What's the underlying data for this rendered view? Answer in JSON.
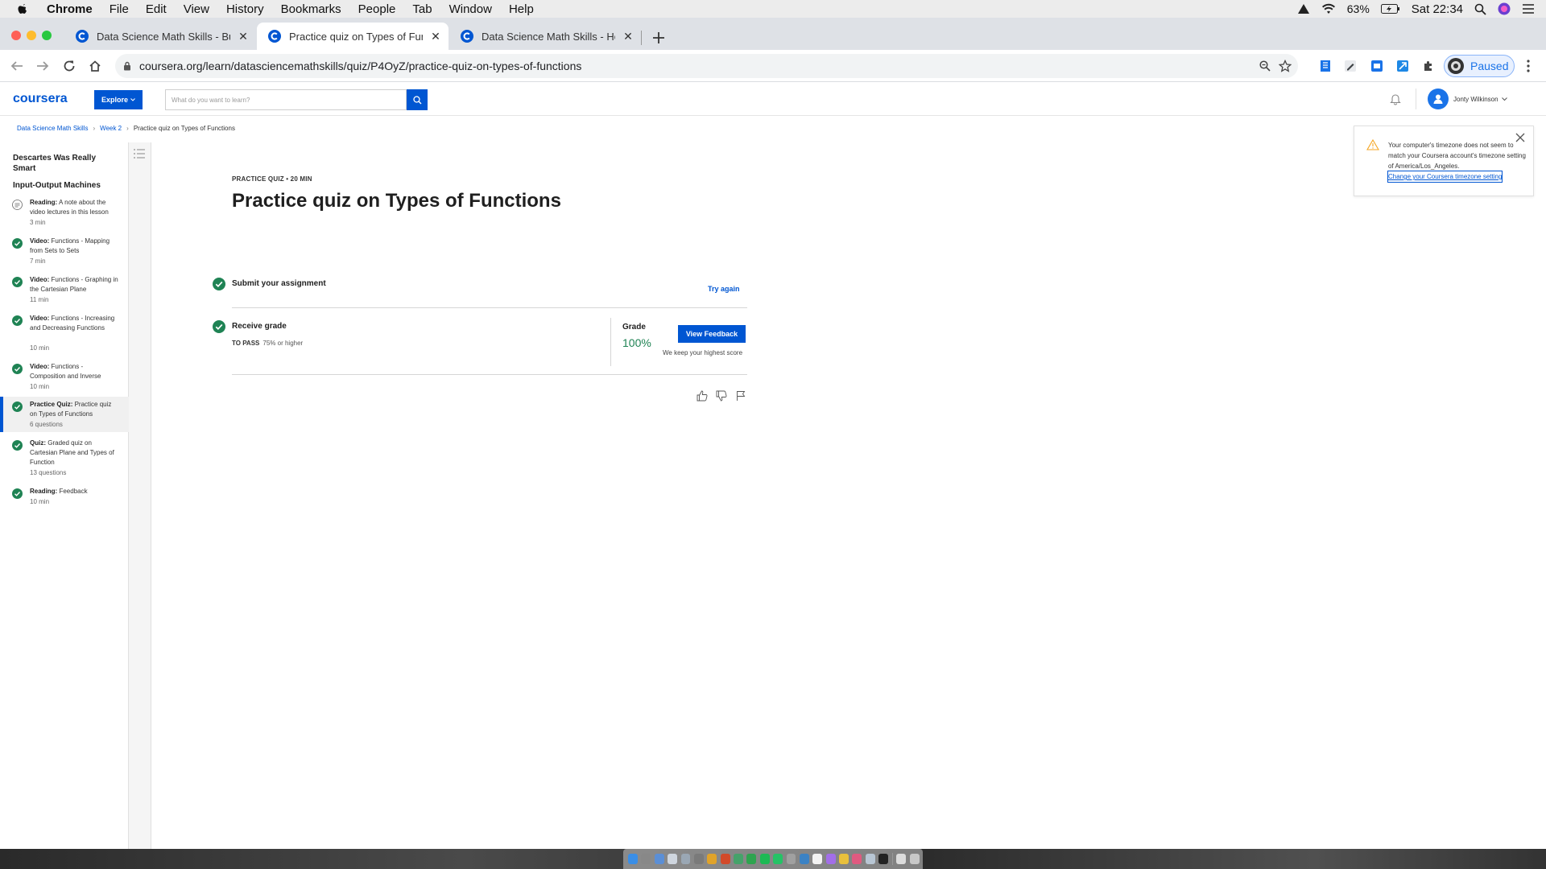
{
  "menubar": {
    "app_name": "Chrome",
    "items": [
      "File",
      "Edit",
      "View",
      "History",
      "Bookmarks",
      "People",
      "Tab",
      "Window",
      "Help"
    ],
    "battery": "63%",
    "clock": "Sat 22:34"
  },
  "browser": {
    "tabs": [
      {
        "title": "Data Science Math Skills - Buil"
      },
      {
        "title": "Practice quiz on Types of Func"
      },
      {
        "title": "Data Science Math Skills - Hon"
      }
    ],
    "url": "coursera.org/learn/datasciencemathskills/quiz/P4OyZ/practice-quiz-on-types-of-functions",
    "profile_status": "Paused"
  },
  "header": {
    "logo": "coursera",
    "explore_label": "Explore",
    "search_placeholder": "What do you want to learn?",
    "user_name": "Jonty Wilkinson"
  },
  "breadcrumb": {
    "course": "Data Science Math Skills",
    "week": "Week 2",
    "current": "Practice quiz on Types of Functions"
  },
  "timezone_notice": {
    "message": "Your computer's timezone does not seem to match your Coursera account's timezone setting of America/Los_Angeles.",
    "link": "Change your Coursera timezone setting"
  },
  "sidebar": {
    "lesson_title": "Descartes Was Really Smart",
    "section_title": "Input-Output Machines",
    "items": [
      {
        "type": "Reading:",
        "title": "A note about the video lectures in this lesson",
        "meta": "3 min"
      },
      {
        "type": "Video:",
        "title": "Functions - Mapping from Sets to Sets",
        "meta": "7 min"
      },
      {
        "type": "Video:",
        "title": "Functions - Graphing in the Cartesian Plane",
        "meta": "11 min"
      },
      {
        "type": "Video:",
        "title": "Functions - Increasing and Decreasing Functions",
        "meta": "10 min"
      },
      {
        "type": "Video:",
        "title": "Functions - Composition and Inverse",
        "meta": "10 min"
      },
      {
        "type": "Practice Quiz:",
        "title": "Practice quiz on Types of Functions",
        "meta": "6 questions"
      },
      {
        "type": "Quiz:",
        "title": "Graded quiz on Cartesian Plane and Types of Function",
        "meta": "13 questions"
      },
      {
        "type": "Reading:",
        "title": "Feedback",
        "meta": "10 min"
      }
    ]
  },
  "main": {
    "eyebrow": "PRACTICE QUIZ • 20 MIN",
    "title": "Practice quiz on Types of Functions",
    "submit_label": "Submit your assignment",
    "try_again": "Try again",
    "receive_label": "Receive grade",
    "to_pass_label": "TO PASS",
    "to_pass_value": "75% or higher",
    "grade_label": "Grade",
    "grade_value": "100%",
    "view_feedback": "View Feedback",
    "keep_note": "We keep your highest score"
  },
  "colors": {
    "brand": "#0056d2",
    "success": "#1f8354"
  }
}
